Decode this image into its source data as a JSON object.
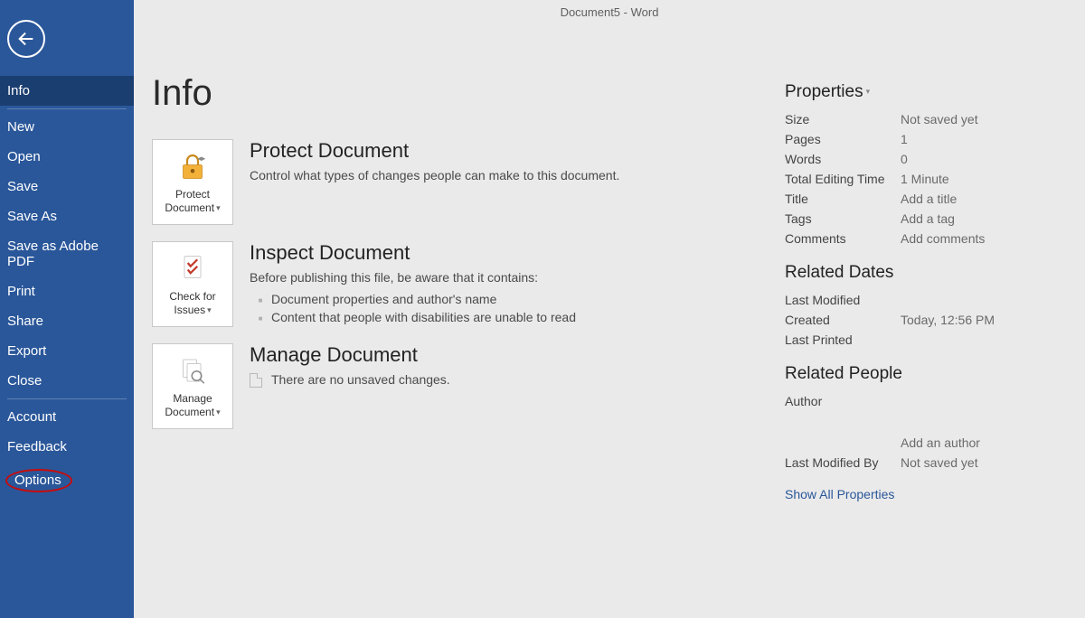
{
  "titlebar": "Document5  -  Word",
  "sidebar": {
    "items": [
      {
        "label": "Info",
        "selected": true
      },
      {
        "label": "New"
      },
      {
        "label": "Open"
      },
      {
        "label": "Save"
      },
      {
        "label": "Save As"
      },
      {
        "label": "Save as Adobe PDF"
      },
      {
        "label": "Print"
      },
      {
        "label": "Share"
      },
      {
        "label": "Export"
      },
      {
        "label": "Close"
      },
      {
        "label": "Account"
      },
      {
        "label": "Feedback"
      },
      {
        "label": "Options",
        "highlighted": true
      }
    ]
  },
  "page": {
    "title": "Info"
  },
  "sections": {
    "protect": {
      "tile_label": "Protect Document",
      "title": "Protect Document",
      "desc": "Control what types of changes people can make to this document."
    },
    "inspect": {
      "tile_label": "Check for Issues",
      "title": "Inspect Document",
      "desc": "Before publishing this file, be aware that it contains:",
      "bullets": [
        "Document properties and author's name",
        "Content that people with disabilities are unable to read"
      ]
    },
    "manage": {
      "tile_label": "Manage Document",
      "title": "Manage Document",
      "desc": "There are no unsaved changes."
    }
  },
  "properties": {
    "heading": "Properties",
    "rows": [
      {
        "key": "Size",
        "value": "Not saved yet"
      },
      {
        "key": "Pages",
        "value": "1"
      },
      {
        "key": "Words",
        "value": "0"
      },
      {
        "key": "Total Editing Time",
        "value": "1 Minute"
      },
      {
        "key": "Title",
        "value": "Add a title"
      },
      {
        "key": "Tags",
        "value": "Add a tag"
      },
      {
        "key": "Comments",
        "value": "Add comments"
      }
    ],
    "related_dates_heading": "Related Dates",
    "related_dates": [
      {
        "key": "Last Modified",
        "value": ""
      },
      {
        "key": "Created",
        "value": "Today, 12:56 PM"
      },
      {
        "key": "Last Printed",
        "value": ""
      }
    ],
    "related_people_heading": "Related People",
    "author_key": "Author",
    "add_author": "Add an author",
    "last_modified_by_key": "Last Modified By",
    "last_modified_by_value": "Not saved yet",
    "show_all": "Show All Properties"
  }
}
